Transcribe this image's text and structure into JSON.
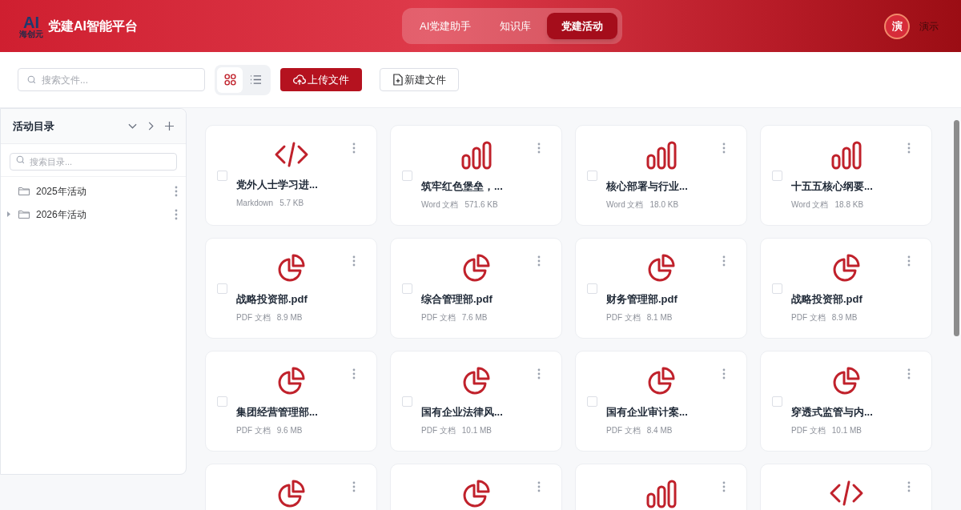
{
  "header": {
    "logo": {
      "mark": "AI",
      "caption": "海创元"
    },
    "title": "党建AI智能平台",
    "nav": [
      {
        "label": "AI党建助手",
        "selected": false
      },
      {
        "label": "知识库",
        "selected": false
      },
      {
        "label": "党建活动",
        "selected": true
      }
    ],
    "user": {
      "avatar": "演",
      "name": "演示"
    }
  },
  "toolbar": {
    "search": {
      "placeholder": "搜索文件..."
    },
    "views": [
      {
        "kind": "grid",
        "selected": true
      },
      {
        "kind": "list",
        "selected": false
      }
    ],
    "upload": "上传文件",
    "new_file": "新建文件"
  },
  "sidebar": {
    "title": "活动目录",
    "search": {
      "placeholder": "搜索目录..."
    },
    "items": [
      {
        "label": "2025年活动",
        "expandable": false
      },
      {
        "label": "2026年活动",
        "expandable": true
      }
    ]
  },
  "files": [
    {
      "kind": "code",
      "name": "党外人士学习进...",
      "type": "Markdown",
      "size": "5.7 KB",
      "checked": false
    },
    {
      "kind": "word",
      "name": "筑牢红色堡垒，...",
      "type": "Word 文档",
      "size": "571.6 KB",
      "checked": false
    },
    {
      "kind": "word",
      "name": "核心部署与行业...",
      "type": "Word 文档",
      "size": "18.0 KB",
      "checked": false
    },
    {
      "kind": "word",
      "name": "十五五核心纲要...",
      "type": "Word 文档",
      "size": "18.8 KB",
      "checked": false
    },
    {
      "kind": "pdf",
      "name": "战略投资部.pdf",
      "type": "PDF 文档",
      "size": "8.9 MB",
      "checked": false
    },
    {
      "kind": "pdf",
      "name": "综合管理部.pdf",
      "type": "PDF 文档",
      "size": "7.6 MB",
      "checked": false
    },
    {
      "kind": "pdf",
      "name": "财务管理部.pdf",
      "type": "PDF 文档",
      "size": "8.1 MB",
      "checked": false
    },
    {
      "kind": "pdf",
      "name": "战略投资部.pdf",
      "type": "PDF 文档",
      "size": "8.9 MB",
      "checked": false
    },
    {
      "kind": "pdf",
      "name": "集团经营管理部...",
      "type": "PDF 文档",
      "size": "9.6 MB",
      "checked": false
    },
    {
      "kind": "pdf",
      "name": "国有企业法律风...",
      "type": "PDF 文档",
      "size": "10.1 MB",
      "checked": false
    },
    {
      "kind": "pdf",
      "name": "国有企业审计案...",
      "type": "PDF 文档",
      "size": "8.4 MB",
      "checked": false
    },
    {
      "kind": "pdf",
      "name": "穿透式监管与内...",
      "type": "PDF 文档",
      "size": "10.1 MB",
      "checked": false
    },
    {
      "kind": "pdf"
    },
    {
      "kind": "pdf"
    },
    {
      "kind": "word"
    },
    {
      "kind": "code"
    }
  ]
}
